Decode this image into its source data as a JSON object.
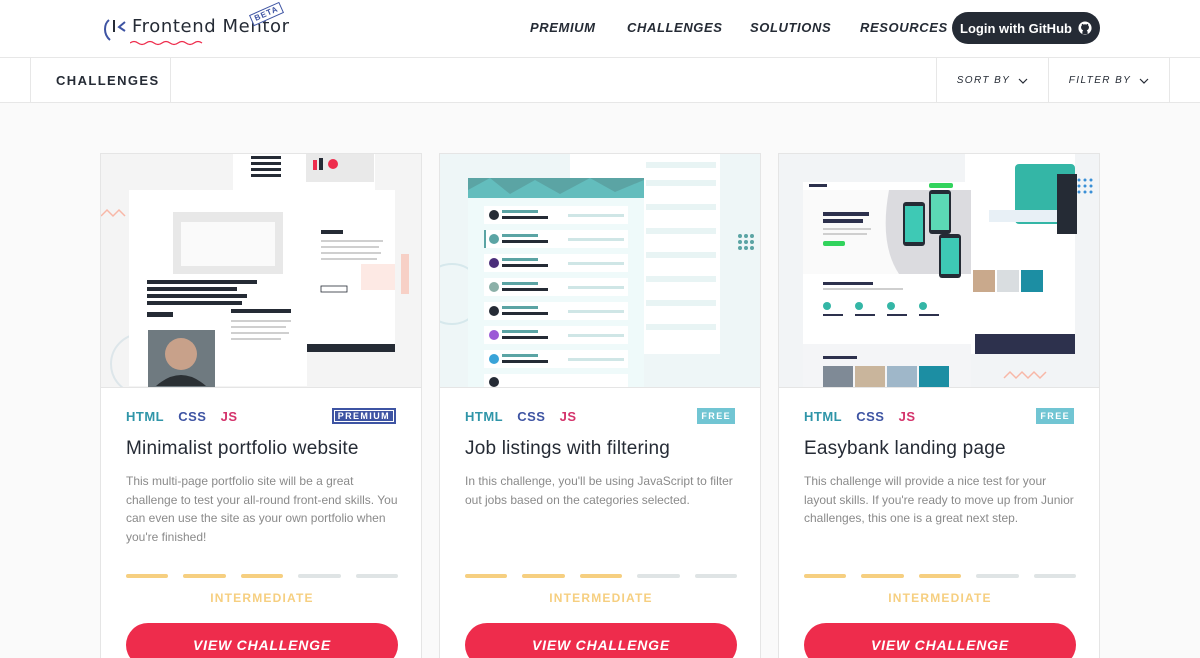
{
  "header": {
    "logo_text": "Frontend Mentor",
    "beta_label": "BETA",
    "nav": [
      {
        "label": "PREMIUM"
      },
      {
        "label": "CHALLENGES"
      },
      {
        "label": "SOLUTIONS"
      },
      {
        "label": "RESOURCES"
      }
    ],
    "login_label": "Login with GitHub"
  },
  "subbar": {
    "title": "CHALLENGES",
    "sort_label": "SORT BY",
    "filter_label": "FILTER BY"
  },
  "colors": {
    "accent": "#ee2c4c",
    "dark": "#252b35",
    "html": "#2f95a8",
    "css": "#3e54a3",
    "js": "#d4336b",
    "intermediate": "#f6cf80",
    "free_badge": "#71c5d3"
  },
  "cards": [
    {
      "tags": [
        "HTML",
        "CSS",
        "JS"
      ],
      "badge": "PREMIUM",
      "title": "Minimalist portfolio website",
      "description": "This multi-page portfolio site will be a great challenge to test your all-round front-end skills. You can even use the site as your own portfolio when you're finished!",
      "level_fraction": 0.6,
      "level": "INTERMEDIATE",
      "cta": "VIEW CHALLENGE",
      "preview": {
        "hero_text": "Hey, I'm Alex Spencer and I love building beautiful websites",
        "section_label": "About Me"
      }
    },
    {
      "tags": [
        "HTML",
        "CSS",
        "JS"
      ],
      "badge": "FREE",
      "title": "Job listings with filtering",
      "description": "In this challenge, you'll be using JavaScript to filter out jobs based on the categories selected.",
      "level_fraction": 0.6,
      "level": "INTERMEDIATE",
      "cta": "VIEW CHALLENGE",
      "preview": {}
    },
    {
      "tags": [
        "HTML",
        "CSS",
        "JS"
      ],
      "badge": "FREE",
      "title": "Easybank landing page",
      "description": "This challenge will provide a nice test for your layout skills. If you're ready to move up from Junior challenges, this one is a great next step.",
      "level_fraction": 0.6,
      "level": "INTERMEDIATE",
      "cta": "VIEW CHALLENGE",
      "preview": {
        "hero_text": "Next generation digital banking",
        "section_label": "Why choose Easybank?",
        "articles_label": "Latest Articles"
      }
    }
  ]
}
